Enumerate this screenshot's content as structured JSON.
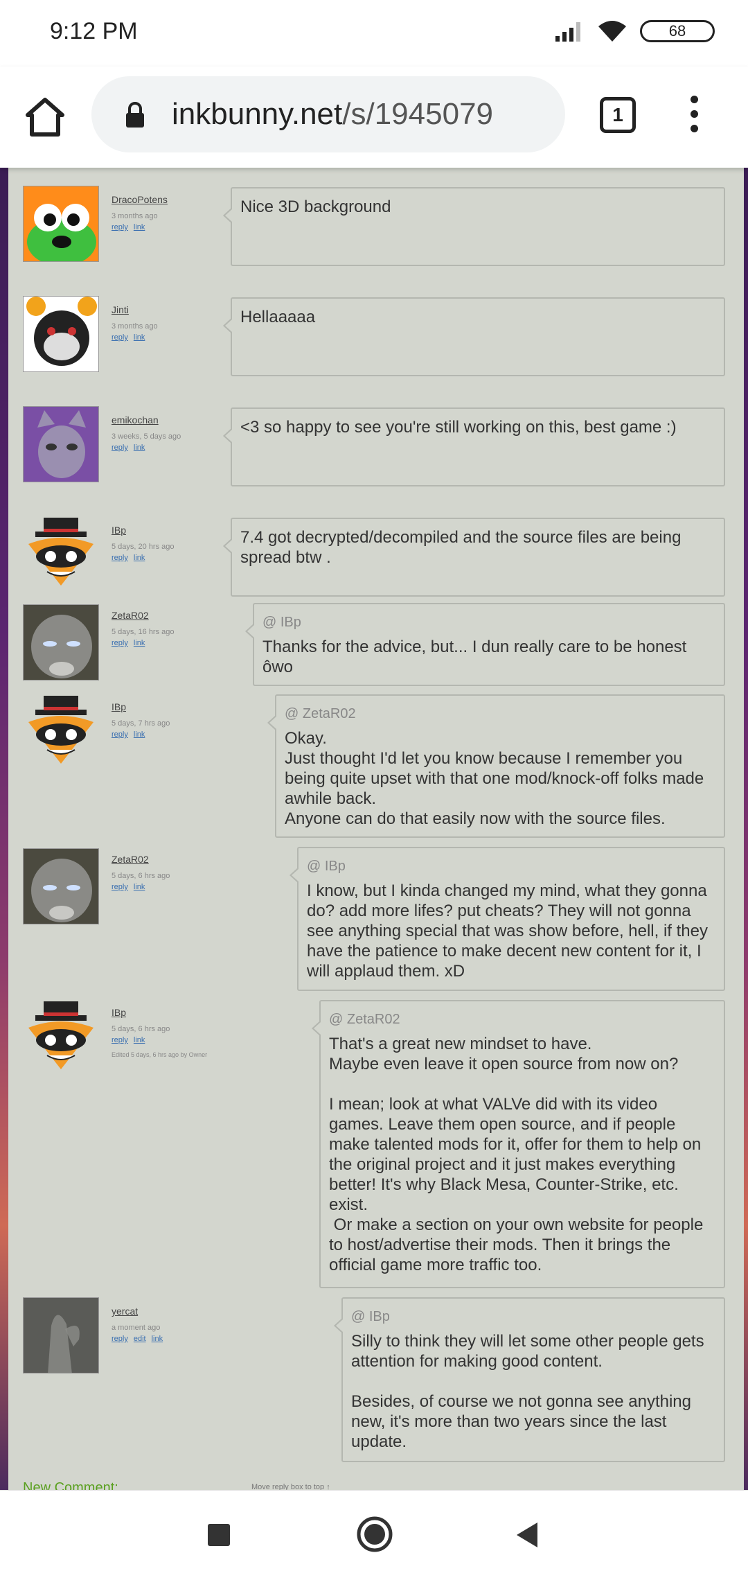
{
  "status": {
    "time": "9:12 PM",
    "battery": "68"
  },
  "browser": {
    "url_domain": "inkbunny.net",
    "url_path": "/s/1945079",
    "tab_count": "1"
  },
  "comments": [
    {
      "user": "DracoPotens",
      "time": "3 months ago",
      "reply": "reply",
      "link": "link",
      "reply_to": "",
      "text": "Nice 3D background"
    },
    {
      "user": "Jinti",
      "time": "3 months ago",
      "reply": "reply",
      "link": "link",
      "reply_to": "",
      "text": "Hellaaaaa"
    },
    {
      "user": "emikochan",
      "time": "3 weeks, 5 days ago",
      "reply": "reply",
      "link": "link",
      "reply_to": "",
      "text": "<3 so happy to see you're still working on this, best game :)"
    },
    {
      "user": "IBp",
      "time": "5 days, 20 hrs ago",
      "reply": "reply",
      "link": "link",
      "reply_to": "",
      "text": "7.4 got decrypted/decompiled and the source files are being spread btw ."
    },
    {
      "user": "ZetaR02",
      "time": "5 days, 16 hrs ago",
      "reply": "reply",
      "link": "link",
      "reply_to": "@ IBp",
      "text": "Thanks for the advice, but... I dun really care to be honest ôwo"
    },
    {
      "user": "IBp",
      "time": "5 days, 7 hrs ago",
      "reply": "reply",
      "link": "link",
      "reply_to": "@ ZetaR02",
      "text": "Okay.\nJust thought I'd let you know because I remember you being quite upset with that one mod/knock-off folks made awhile back.\nAnyone can do that easily now with the source files."
    },
    {
      "user": "ZetaR02",
      "time": "5 days, 6 hrs ago",
      "reply": "reply",
      "link": "link",
      "reply_to": "@ IBp",
      "text": "I know, but I kinda changed my mind, what they gonna do? add more lifes? put cheats? They will not gonna see anything special that was show before, hell, if they have the patience to make decent new content for it, I will applaud them. xD"
    },
    {
      "user": "IBp",
      "time": "5 days, 6 hrs ago",
      "reply": "reply",
      "link": "link",
      "edited": "Edited 5 days, 6 hrs ago by Owner",
      "reply_to": "@ ZetaR02",
      "text": "That's a great new mindset to have.\nMaybe even leave it open source from now on?\n\nI mean; look at what VALVe did with its video games. Leave them open source, and if people make talented mods for it, offer for them to help on the original project and it just makes everything better! It's why Black Mesa, Counter-Strike, etc. exist.\n Or make a section on your own website for people to host/advertise their mods. Then it brings the official game more traffic too."
    },
    {
      "user": "yercat",
      "time": "a moment ago",
      "reply": "reply",
      "edit": "edit",
      "link": "link",
      "reply_to": "@ IBp",
      "text": "Silly to think they will let some other people gets attention for making good content.\n\nBesides, of course we not gonna see anything new, it's more than two years since the last update."
    }
  ],
  "footer": {
    "new_comment": "New Comment:",
    "move_reply": "Move reply box to top ↑"
  },
  "colors": {
    "panel": "#d3d6ce",
    "link": "#3a6fb0",
    "new_comment": "#5aa020"
  }
}
